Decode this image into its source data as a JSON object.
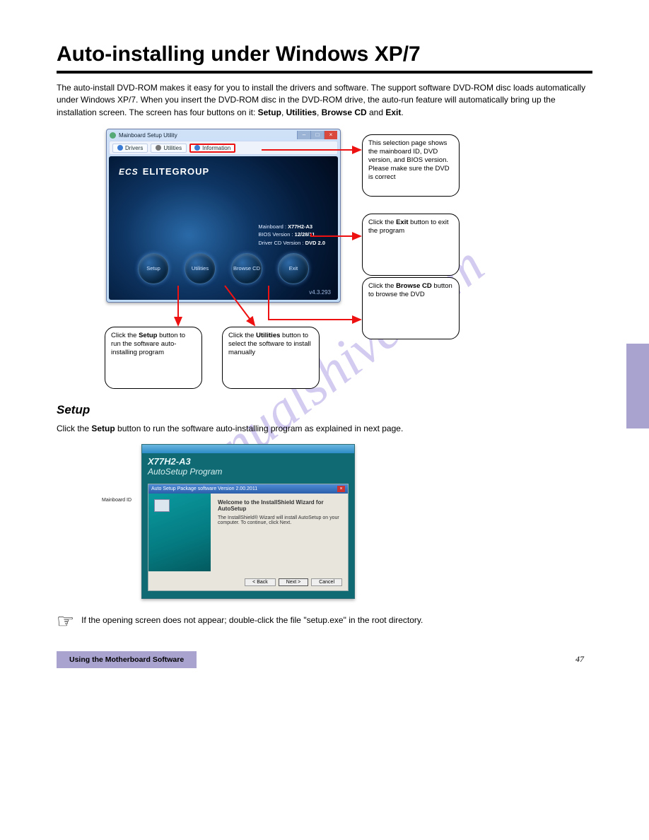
{
  "page": {
    "headline": "Auto-installing under Windows XP/7",
    "intro": "The auto-install DVD-ROM makes it easy for you to install the drivers and software. The support software DVD-ROM disc loads automatically under Windows XP/7. When you insert the DVD-ROM disc in the DVD-ROM drive, the auto-run feature will automatically bring up the installation screen. The screen has four buttons on it: <b>Setup</b>, <b>Utilities</b>, <b>Browse CD</b> and <b>Exit</b>.",
    "folio": "47"
  },
  "watermark": "manualshive.com",
  "setup_util": {
    "title": "Mainboard Setup Utility",
    "tabs": {
      "drivers": "Drivers",
      "utilities": "Utilities",
      "information": "Information"
    },
    "brand": "ELITEGROUP",
    "brand_prefix": "ECS",
    "sysinfo": {
      "mainboard_label": "Mainboard :",
      "mainboard": "X77H2-A3",
      "bios_label": "BIOS Version :",
      "bios": "12/28/11",
      "cd_label": "Driver CD Version :",
      "cd": "DVD 2.0"
    },
    "buttons": {
      "setup": "Setup",
      "utilities": "Utilities",
      "browse": "Browse CD",
      "exit": "Exit"
    },
    "version": "v4.3.293"
  },
  "callouts": {
    "c1": "This selection page shows the mainboard ID, DVD version, and BIOS version. Please make sure the DVD is correct",
    "c2": "Click the <b>Exit</b> button to exit the program",
    "c3": "Click the <b>Browse CD</b> button to browse the DVD",
    "c4": "Click the <b>Setup</b> button to run the software auto-installing program",
    "c5": "Click the <b>Utilities</b> button to select the software to install manually"
  },
  "setup_section": {
    "heading": "Setup",
    "text": "Click the <b>Setup</b> button to run the software auto-installing program as explained in next page.",
    "model": "X77H2-A3",
    "program": "AutoSetup Program",
    "wizard_bar": "Auto Setup Package software Version 2.00.2011",
    "wizard_welcome": "Welcome to the InstallShield Wizard for AutoSetup",
    "wizard_body": "The InstallShield® Wizard will install AutoSetup on your computer. To continue, click Next.",
    "side_label": "Mainboard ID",
    "buttons": {
      "back": "< Back",
      "next": "Next >",
      "cancel": "Cancel"
    }
  },
  "note": "If the opening screen does not appear; double-click the file \"setup.exe\" in the root directory.",
  "footer": {
    "chapter": "Using the Motherboard Software"
  }
}
